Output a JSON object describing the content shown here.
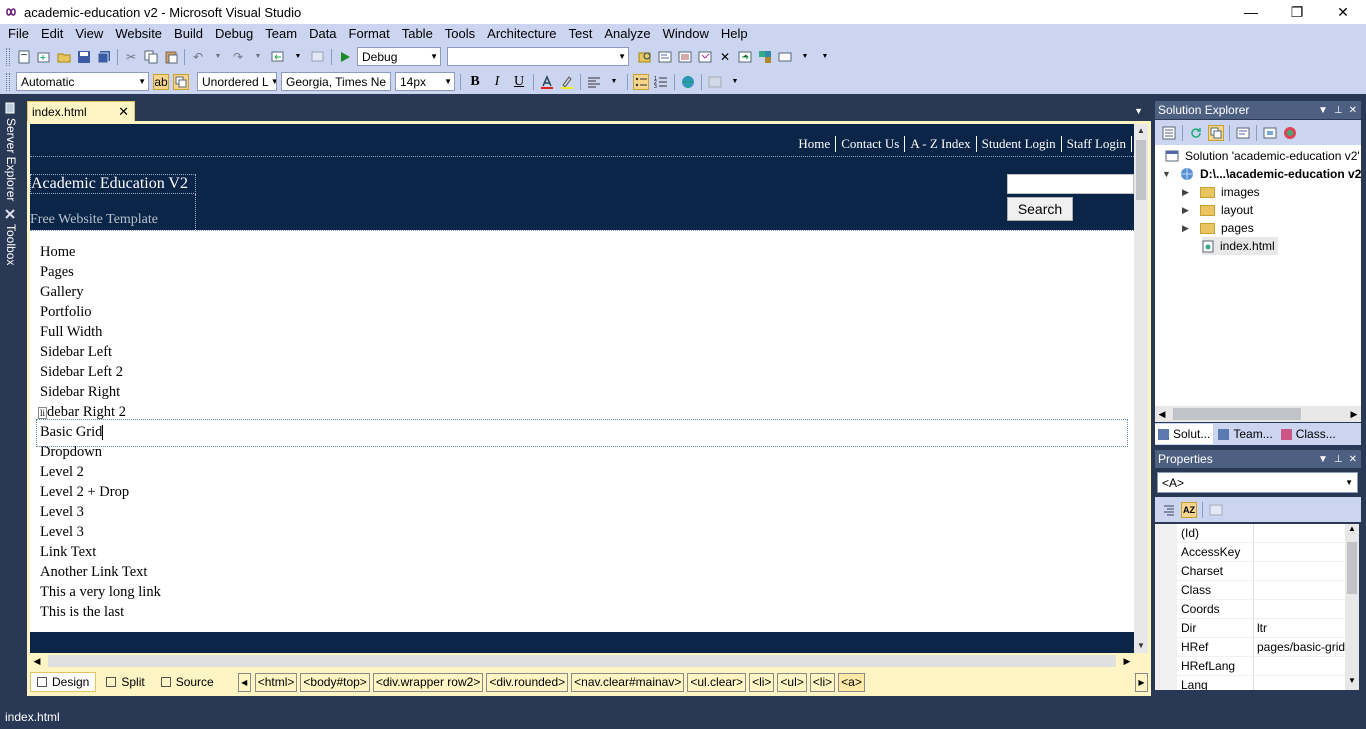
{
  "window": {
    "title": "academic-education v2 - Microsoft Visual Studio",
    "minimize": "—",
    "restore": "❐",
    "close": "✕"
  },
  "menu": [
    "File",
    "Edit",
    "View",
    "Website",
    "Build",
    "Debug",
    "Team",
    "Data",
    "Format",
    "Table",
    "Tools",
    "Architecture",
    "Test",
    "Analyze",
    "Window",
    "Help"
  ],
  "toolbar": {
    "config_combo": "Debug",
    "platform_combo": "",
    "style_combo": "Automatic",
    "block_format_combo": "Unordered L",
    "font_combo": "Georgia, Times Ne",
    "size_combo": "14px",
    "bold": "B",
    "italic": "I",
    "underline": "U"
  },
  "left_strip": {
    "server_explorer": "Server Explorer",
    "toolbox": "Toolbox"
  },
  "document": {
    "tab_label": "index.html",
    "tab_close": "✕",
    "site": {
      "top_nav": [
        "Home",
        "Contact Us",
        "A - Z Index",
        "Student Login",
        "Staff Login"
      ],
      "title": "Academic Education V2",
      "subtitle": "Free Website Template",
      "search_button": "Search",
      "main_nav": [
        "Home",
        "Pages",
        "Gallery",
        "Portfolio",
        "Full Width",
        "Sidebar Left",
        "Sidebar Left 2",
        "Sidebar Right",
        "Sidebar Right 2",
        "Basic Grid",
        "Dropdown",
        "Level 2",
        "Level 2 + Drop",
        "Level 3",
        "Level 3",
        "Link Text",
        "Another Link Text",
        "This a very long link",
        "This is the last"
      ],
      "li_tag": "li",
      "sidebar_right_2_partial": "debar Right 2"
    }
  },
  "view_tabs": {
    "design": "Design",
    "split": "Split",
    "source": "Source"
  },
  "breadcrumb": [
    "<html>",
    "<body#top>",
    "<div.wrapper row2>",
    "<div.rounded>",
    "<nav.clear#mainav>",
    "<ul.clear>",
    "<li>",
    "<ul>",
    "<li>",
    "<a>"
  ],
  "solution_explorer": {
    "title": "Solution Explorer",
    "solution": "Solution 'academic-education v2'",
    "project": "D:\\...\\academic-education v2",
    "items": [
      {
        "label": "images",
        "type": "folder"
      },
      {
        "label": "layout",
        "type": "folder"
      },
      {
        "label": "pages",
        "type": "folder"
      },
      {
        "label": "index.html",
        "type": "file"
      }
    ],
    "tabs": [
      "Solut...",
      "Team...",
      "Class..."
    ]
  },
  "properties": {
    "title": "Properties",
    "selected_object": "<A>",
    "rows": [
      {
        "name": "(Id)",
        "value": ""
      },
      {
        "name": "AccessKey",
        "value": ""
      },
      {
        "name": "Charset",
        "value": ""
      },
      {
        "name": "Class",
        "value": ""
      },
      {
        "name": "Coords",
        "value": ""
      },
      {
        "name": "Dir",
        "value": "ltr"
      },
      {
        "name": "HRef",
        "value": "pages/basic-grid.html"
      },
      {
        "name": "HRefLang",
        "value": ""
      },
      {
        "name": "Lang",
        "value": ""
      }
    ]
  },
  "status": {
    "text": "index.html"
  },
  "colors": {
    "chrome": "#293955",
    "menu_bg": "#ccd5f0",
    "site_header": "#0a2548",
    "tab_active": "#fff5c4"
  }
}
